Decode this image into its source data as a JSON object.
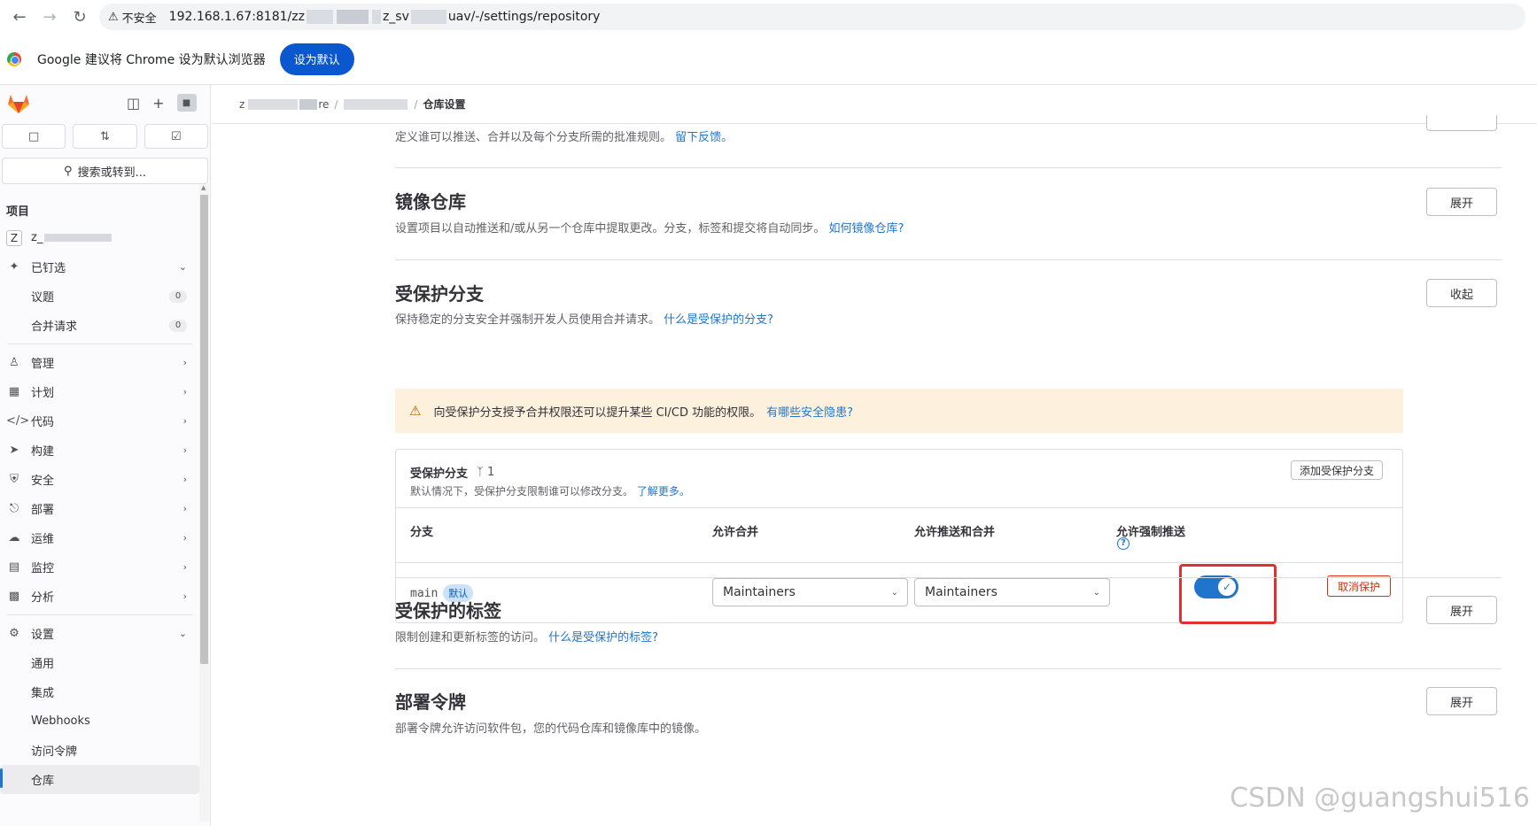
{
  "browser": {
    "security_label": "不安全",
    "url_prefix": "192.168.1.67:8181/zz",
    "url_mid": "z_sv",
    "url_suffix": "uav/-/settings/repository"
  },
  "infobar": {
    "message": "Google 建议将 Chrome 设为默认浏览器",
    "button_label": "设为默认"
  },
  "sidebar": {
    "search_label": "搜索或转到...",
    "section_title": "项目",
    "project_initial": "Z",
    "project_name": "z_",
    "pinned_label": "已钉选",
    "pinned_items": [
      {
        "label": "议题",
        "count": "0"
      },
      {
        "label": "合并请求",
        "count": "0"
      }
    ],
    "nav_items": [
      {
        "label": "管理",
        "icon": "users-icon"
      },
      {
        "label": "计划",
        "icon": "calendar-icon"
      },
      {
        "label": "代码",
        "icon": "code-icon"
      },
      {
        "label": "构建",
        "icon": "rocket-icon"
      },
      {
        "label": "安全",
        "icon": "shield-icon"
      },
      {
        "label": "部署",
        "icon": "deploy-icon"
      },
      {
        "label": "运维",
        "icon": "cloud-icon"
      },
      {
        "label": "监控",
        "icon": "monitor-icon"
      },
      {
        "label": "分析",
        "icon": "chart-icon"
      }
    ],
    "settings_label": "设置",
    "settings_items": [
      "通用",
      "集成",
      "Webhooks",
      "访问令牌",
      "仓库"
    ],
    "active_settings_item": "仓库"
  },
  "breadcrumb": {
    "part1": "z",
    "part2": "re",
    "current": "仓库设置"
  },
  "sections": {
    "top_desc": "定义谁可以推送、合并以及每个分支所需的批准规则。",
    "top_desc_link": "留下反馈。",
    "mirror": {
      "title": "镜像仓库",
      "desc": "设置项目以自动推送和/或从另一个仓库中提取更改。分支，标签和提交将自动同步。",
      "link": "如何镜像仓库?",
      "button": "展开"
    },
    "protected_branches": {
      "title": "受保护分支",
      "desc": "保持稳定的分支安全并强制开发人员使用合并请求。",
      "link": "什么是受保护的分支?",
      "button": "收起",
      "alert_text": "向受保护分支授予合并权限还可以提升某些 CI/CD 功能的权限。",
      "alert_link": "有哪些安全隐患?",
      "card_title": "受保护分支",
      "card_count": "1",
      "card_sub": "默认情况下，受保护分支限制谁可以修改分支。",
      "card_sub_link": "了解更多。",
      "add_button": "添加受保护分支",
      "columns": [
        "分支",
        "允许合并",
        "允许推送和合并",
        "允许强制推送"
      ],
      "rows": [
        {
          "branch": "main",
          "badge": "默认",
          "allowed_to_merge": "Maintainers",
          "allowed_to_push": "Maintainers",
          "force_push_enabled": true,
          "unprotect_label": "取消保护"
        }
      ]
    },
    "protected_tags": {
      "title": "受保护的标签",
      "desc": "限制创建和更新标签的访问。",
      "link": "什么是受保护的标签?",
      "button": "展开"
    },
    "deploy_tokens": {
      "title": "部署令牌",
      "desc": "部署令牌允许访问软件包，您的代码仓库和镜像库中的镜像。",
      "button": "展开"
    }
  },
  "watermark": "CSDN @guangshui516",
  "colors": {
    "accent": "#1f75cb",
    "danger": "#dd2b0e",
    "alert_bg": "#fdf1dd",
    "highlight": "#e03131"
  }
}
